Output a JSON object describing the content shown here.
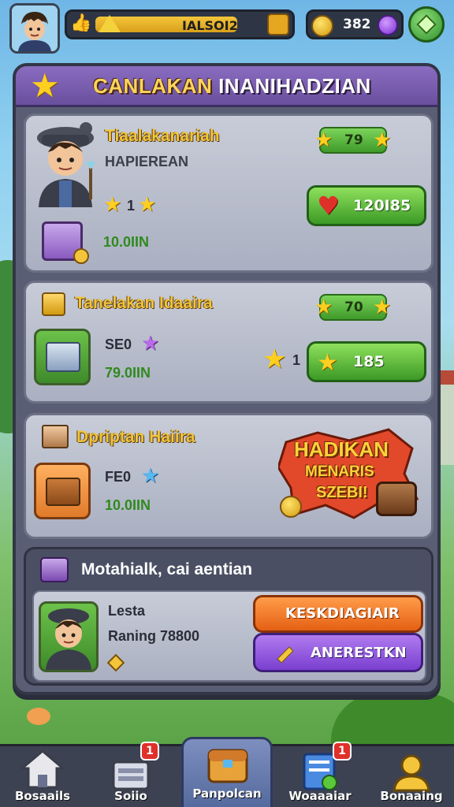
{
  "topbar": {
    "resource_value": "IALSOI2",
    "coins_value": "382"
  },
  "panel": {
    "title_main": "CANLAKAN",
    "title_rest": "INANIHADZIAN"
  },
  "card1": {
    "title": "Tiaalakanariah",
    "subtitle": "HAPIEREAN",
    "level": "79",
    "stars_count": "1",
    "timer": "10.0IIN",
    "button_label": "120I85",
    "button_icon": "heart-icon"
  },
  "card2": {
    "title": "Tanelakan Idaaira",
    "level": "70",
    "cost": "SE0",
    "timer": "79.0IIN",
    "star_count": "1",
    "button_label": "185"
  },
  "card3": {
    "title": "Dpriptan Haiira",
    "cost": "FE0",
    "timer": "10.0IIN",
    "promo_line1": "HADIKAN",
    "promo_line2": "MENARIS",
    "promo_line3": "SZEBI!"
  },
  "event": {
    "title": "Motahialk, cai aentian",
    "name": "Lesta",
    "ranking": "Raning 78800",
    "orange_label": "KESKDIAGIAIR",
    "purple_label": "ANERESTKN"
  },
  "nav": [
    {
      "label": "Bosaails",
      "icon": "home-icon"
    },
    {
      "label": "Soiio",
      "icon": "shop-icon",
      "badge": "1"
    },
    {
      "label": "Panpolcan",
      "icon": "chest-icon"
    },
    {
      "label": "Woaaaiar",
      "icon": "quest-icon",
      "badge": "1"
    },
    {
      "label": "Bonaaing",
      "icon": "profile-icon"
    }
  ],
  "colors": {
    "panel": "#5a5e74",
    "header": "#7a5db0",
    "green_button": "#4fae30",
    "orange_button": "#f07424",
    "purple_button": "#8e52dd",
    "title_gold": "#f0c43a"
  }
}
